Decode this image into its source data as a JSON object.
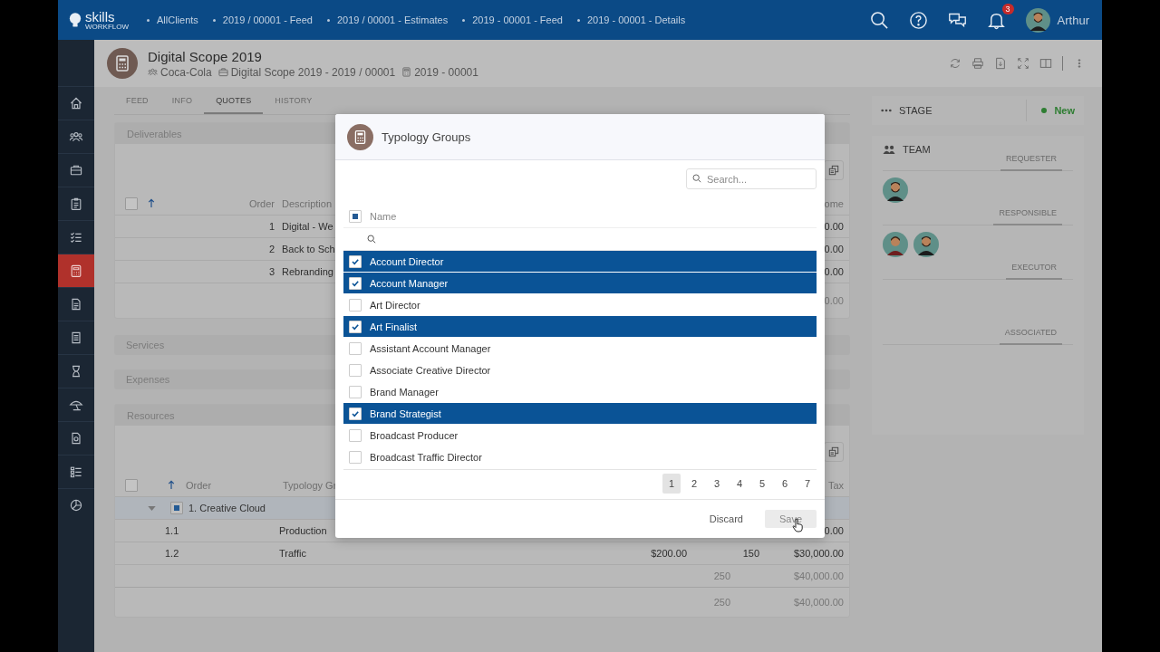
{
  "top_bar": {
    "logo": {
      "name": "skills",
      "tagline": "WORKFLOW"
    },
    "breadcrumbs": [
      "AllClients",
      "2019 / 00001 - Feed",
      "2019 / 00001 - Estimates",
      "2019 - 00001 - Feed",
      "2019 - 00001 - Details"
    ],
    "notification_count": "3",
    "user": "Arthur"
  },
  "sidebar": {
    "items": [
      {
        "kind": "home",
        "selected": false
      },
      {
        "kind": "team",
        "selected": false
      },
      {
        "kind": "briefcase",
        "selected": false
      },
      {
        "kind": "clipboard",
        "selected": false
      },
      {
        "kind": "checklist",
        "selected": false
      },
      {
        "kind": "calculator",
        "selected": true
      },
      {
        "kind": "document",
        "selected": false
      },
      {
        "kind": "invoice",
        "selected": false
      },
      {
        "kind": "hourglass",
        "selected": false
      },
      {
        "kind": "umbrella",
        "selected": false
      },
      {
        "kind": "report",
        "selected": false
      },
      {
        "kind": "list",
        "selected": false
      },
      {
        "kind": "chart",
        "selected": false
      }
    ]
  },
  "header": {
    "title": "Digital Scope 2019",
    "meta": [
      {
        "kind": "client",
        "text": "Coca-Cola"
      },
      {
        "kind": "project",
        "text": "Digital Scope 2019 - 2019 / 00001"
      },
      {
        "kind": "estimate",
        "text": "2019 - 00001"
      }
    ]
  },
  "tabs": [
    {
      "label": "FEED",
      "selected": false
    },
    {
      "label": "INFO",
      "selected": false
    },
    {
      "label": "QUOTES",
      "selected": true
    },
    {
      "label": "HISTORY",
      "selected": false
    }
  ],
  "deliverables": {
    "title": "Deliverables",
    "select_all": {
      "checked": false
    },
    "columns": [
      "Order",
      "Description",
      "ome"
    ],
    "rows": [
      {
        "order": "1",
        "description": "Digital - We",
        "column_3": "0.00"
      },
      {
        "order": "2",
        "description": "Back to Sch",
        "column_3": "0.00"
      },
      {
        "order": "3",
        "description": "Rebranding",
        "column_3": "0.00"
      }
    ],
    "total": "0.00"
  },
  "services": {
    "title": "Services"
  },
  "expenses": {
    "title": "Expenses"
  },
  "resources": {
    "title": "Resources",
    "select_all": {
      "checked": false
    },
    "columns": [
      "Order",
      "Typology Gr",
      "Tax"
    ],
    "group": {
      "label": "1. Creative Cloud",
      "expanded": true,
      "indeterminate": true
    },
    "rows": [
      {
        "order": "1.1",
        "typology": "Production",
        "price": "",
        "quantity": "",
        "column_5": "0.00"
      },
      {
        "order": "1.2",
        "typology": "Traffic",
        "price": "$200.00",
        "quantity": "150",
        "column_5": "$30,000.00"
      }
    ],
    "totals": [
      {
        "quantity": "250",
        "amount": "$40,000.00"
      },
      {
        "quantity": "250",
        "amount": "$40,000.00"
      }
    ]
  },
  "stage": {
    "label": "STAGE",
    "status": "New",
    "color": "#2e7d32"
  },
  "team": {
    "label": "TEAM",
    "roles": [
      {
        "label": "REQUESTER",
        "members": [
          {
            "kind": "man"
          }
        ]
      },
      {
        "label": "RESPONSIBLE",
        "members": [
          {
            "kind": "woman"
          },
          {
            "kind": "man"
          }
        ]
      },
      {
        "label": "EXECUTOR"
      },
      {
        "label": "ASSOCIATED"
      }
    ]
  },
  "dialog": {
    "title": "Typology Groups",
    "search": {
      "placeholder": "Search..."
    },
    "header_checkbox": {
      "indeterminate": true
    },
    "column": "Name",
    "items": [
      {
        "name": "Account Director",
        "checked": true
      },
      {
        "name": "Account Manager",
        "checked": true
      },
      {
        "name": "Art Director",
        "checked": false
      },
      {
        "name": "Art Finalist",
        "checked": true
      },
      {
        "name": "Assistant Account Manager",
        "checked": false
      },
      {
        "name": "Associate Creative Director",
        "checked": false
      },
      {
        "name": "Brand Manager",
        "checked": false
      },
      {
        "name": "Brand Strategist",
        "checked": true
      },
      {
        "name": "Broadcast Producer",
        "checked": false
      },
      {
        "name": "Broadcast Traffic Director",
        "checked": false
      }
    ],
    "pages": [
      {
        "label": "1",
        "selected": true
      },
      {
        "label": "2",
        "selected": false
      },
      {
        "label": "3",
        "selected": false
      },
      {
        "label": "4",
        "selected": false
      },
      {
        "label": "5",
        "selected": false
      },
      {
        "label": "6",
        "selected": false
      },
      {
        "label": "7",
        "selected": false
      }
    ],
    "buttons": [
      {
        "kind": "discard",
        "label": "Discard"
      },
      {
        "kind": "save",
        "label": "Save"
      }
    ]
  }
}
